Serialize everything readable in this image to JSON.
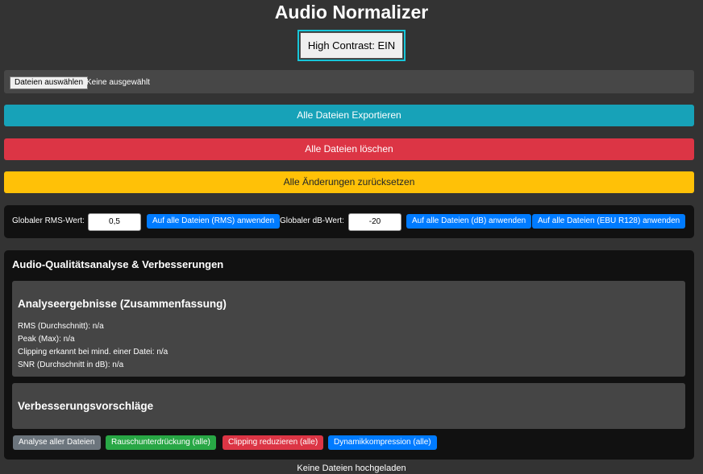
{
  "app": {
    "title": "Audio Normalizer"
  },
  "contrast_toggle": {
    "label": "High Contrast: EIN"
  },
  "file_picker": {
    "button_label": "Dateien auswählen",
    "status": "Keine ausgewählt"
  },
  "actions": {
    "export_all": "Alle Dateien Exportieren",
    "delete_all": "Alle Dateien löschen",
    "reset_all": "Alle Änderungen zurücksetzen"
  },
  "global_settings": {
    "rms_label": "Globaler RMS-Wert:",
    "rms_value": "0,5",
    "rms_apply": "Auf alle Dateien (RMS) anwenden",
    "db_label": "Globaler dB-Wert:",
    "db_value": "-20",
    "db_apply": "Auf alle Dateien (dB) anwenden",
    "ebu_apply": "Auf alle Dateien (EBU R128) anwenden"
  },
  "quality": {
    "title": "Audio-Qualitätsanalyse & Verbesserungen",
    "analysis": {
      "title": "Analyseergebnisse (Zusammenfassung)",
      "rms": "RMS (Durchschnitt): n/a",
      "peak": "Peak (Max): n/a",
      "clipping": "Clipping erkannt bei mind. einer Datei: n/a",
      "snr": "SNR (Durchschnitt in dB): n/a"
    },
    "improvements": {
      "title": "Verbesserungsvorschläge"
    },
    "buttons": {
      "analyze": "Analyse aller Dateien",
      "noise": "Rauschunterdrückung (alle)",
      "clipping": "Clipping reduzieren (alle)",
      "dynamics": "Dynamikkompression (alle)"
    }
  },
  "footer": {
    "status": "Keine Dateien hochgeladen"
  },
  "colors": {
    "background": "#333333",
    "panel": "#111111",
    "info": "#17a2b8",
    "danger": "#dc3545",
    "warning": "#ffc107",
    "primary": "#007bff",
    "success": "#28a745",
    "secondary": "#6c757d",
    "contrast_outline": "#17c6d9"
  }
}
